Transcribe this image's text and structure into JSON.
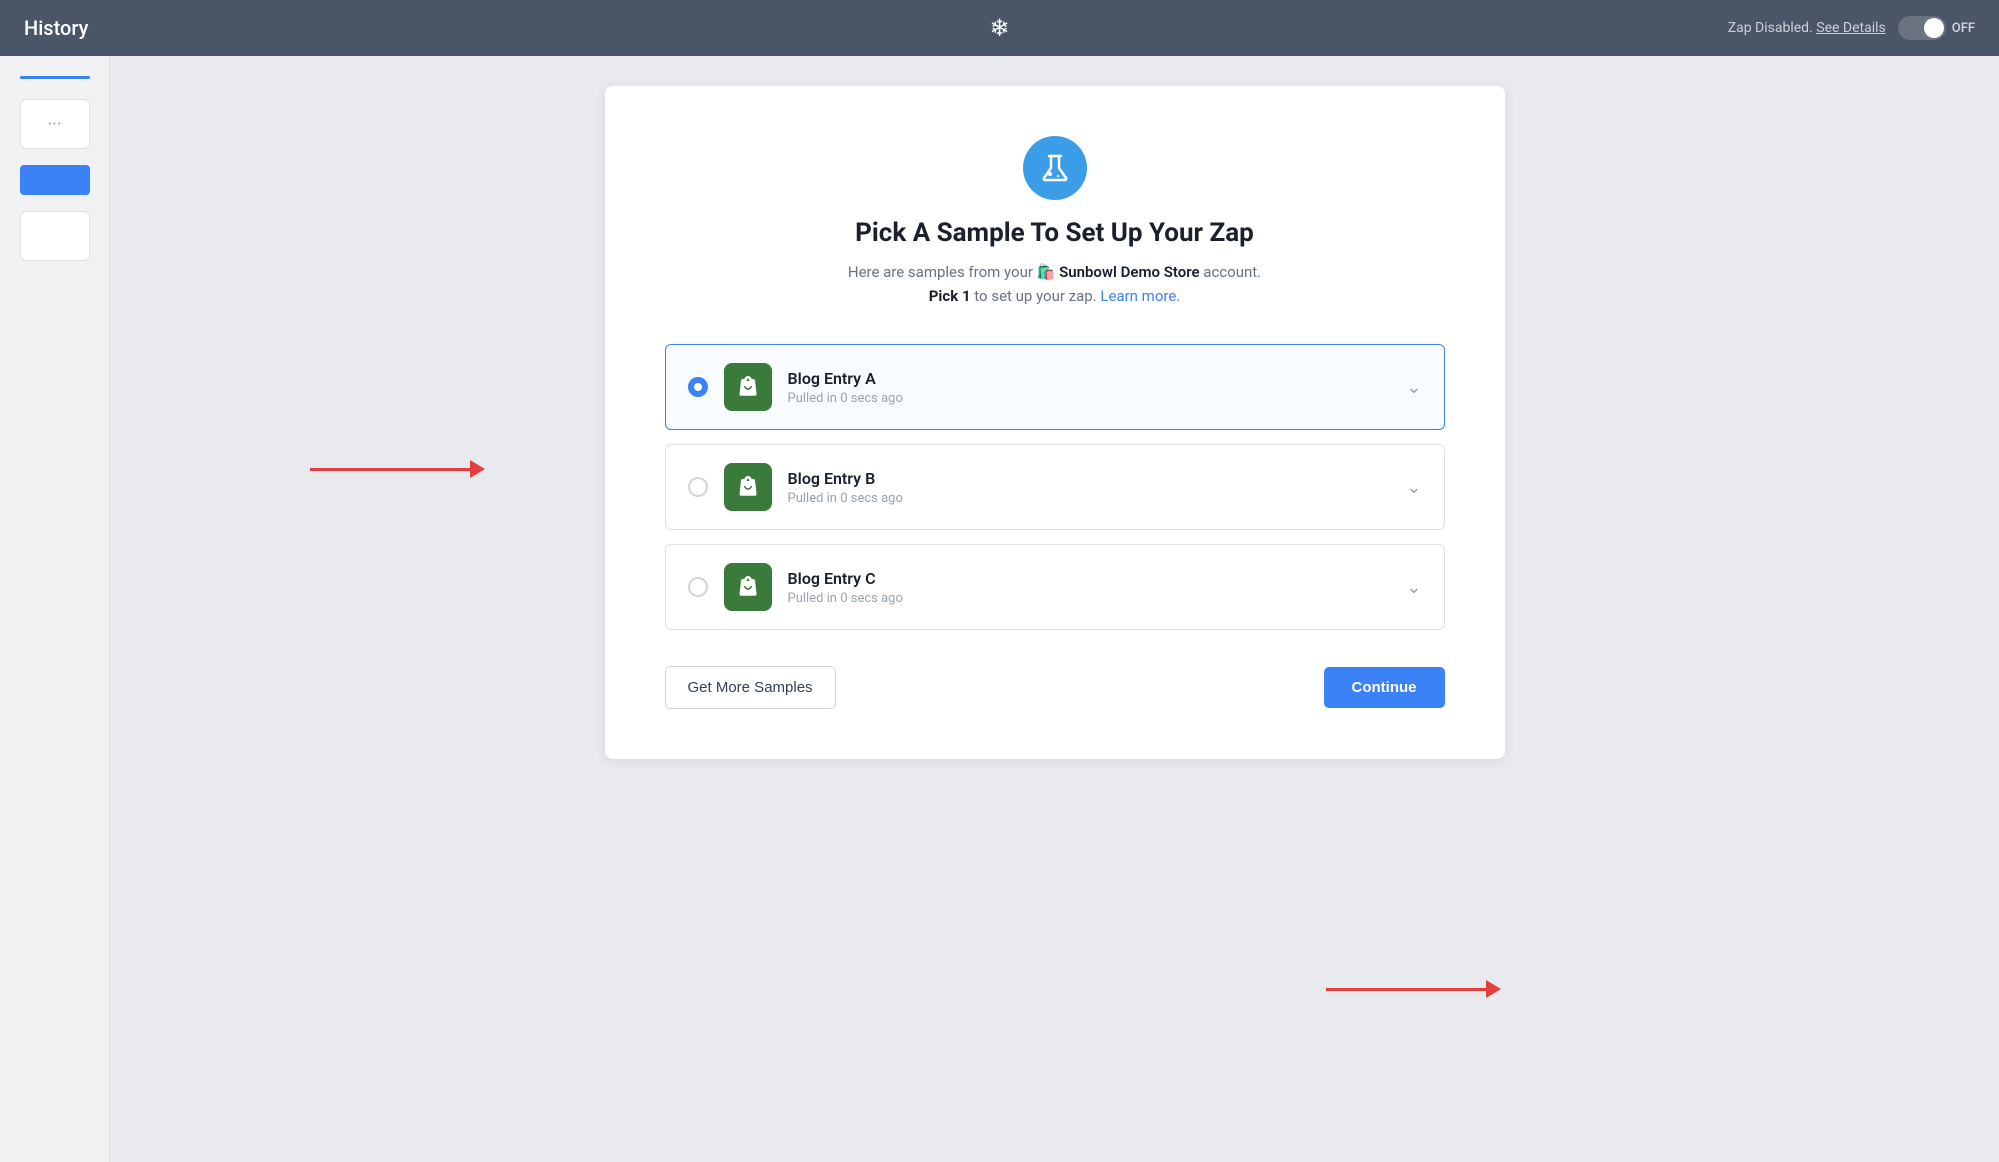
{
  "topbar": {
    "history_label": "History",
    "zap_status_text": "Zap Disabled.",
    "see_details_label": "See Details",
    "toggle_label": "OFF"
  },
  "modal": {
    "title": "Pick A Sample To Set Up Your Zap",
    "subtitle_prefix": "Here are samples from your",
    "store_emoji": "🛍️",
    "store_name": "Sunbowl Demo Store",
    "subtitle_suffix": "account.",
    "pick_label": "Pick 1",
    "pick_suffix": "to set up your zap.",
    "learn_more": "Learn more.",
    "samples": [
      {
        "name": "Blog Entry A",
        "meta": "Pulled in 0 secs ago",
        "selected": true
      },
      {
        "name": "Blog Entry B",
        "meta": "Pulled in 0 secs ago",
        "selected": false
      },
      {
        "name": "Blog Entry C",
        "meta": "Pulled in 0 secs ago",
        "selected": false
      }
    ],
    "get_more_samples_label": "Get More Samples",
    "continue_label": "Continue"
  }
}
